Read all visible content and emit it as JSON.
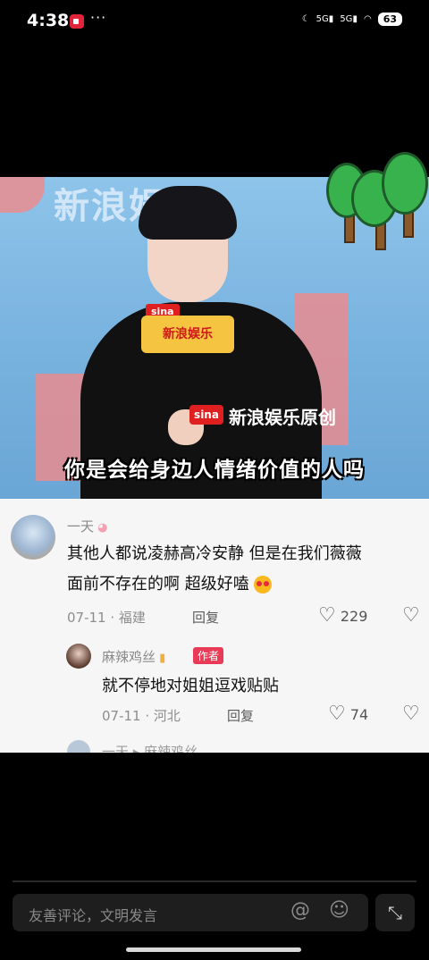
{
  "status_bar": {
    "time": "4:38",
    "dots": "···",
    "signal_1": "5G",
    "signal_2": "5G",
    "battery": "63"
  },
  "video": {
    "banner": "新浪娱乐",
    "mic_brand": "sina",
    "mic_label": "新浪娱乐",
    "logo_mark": "sina",
    "logo_text": "新浪娱乐原创",
    "subtitle": "你是会给身边人情绪价值的人吗"
  },
  "comments": [
    {
      "username": "一天",
      "text_line1": "其他人都说凌赫高冷安静 但是在我们薇薇",
      "text_line2": "面前不存在的啊 超级好嗑",
      "date": "07-11",
      "location": "福建",
      "reply_label": "回复",
      "likes": "229"
    }
  ],
  "reply": {
    "username": "麻辣鸡丝",
    "author_badge": "作者",
    "text": "就不停地对姐姐逗戏贴贴",
    "date": "07-11",
    "location": "河北",
    "reply_label": "回复",
    "likes": "74"
  },
  "partial_next": {
    "username": "一天",
    "reply_to": "麻辣鸡丝"
  },
  "input": {
    "placeholder": "友善评论，文明发言"
  },
  "colors": {
    "author_badge": "#e93a57",
    "panel_bg": "#f6f6f6",
    "video_bg": "#79b3df"
  }
}
